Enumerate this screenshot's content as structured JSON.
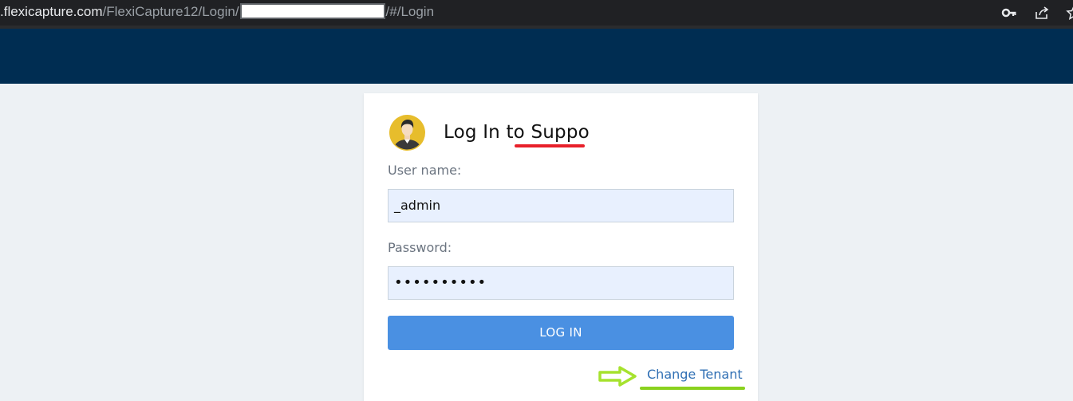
{
  "browser": {
    "url_host": ".flexicapture.com",
    "url_path_before": "/FlexiCapture12/Login/",
    "url_path_after": "/#/Login"
  },
  "login": {
    "title_prefix": "Log In to ",
    "tenant_name": "Suppo",
    "username_label": "User name:",
    "username_value": "_admin",
    "password_label": "Password:",
    "password_value": "••••••••••",
    "login_button": "LOG IN",
    "change_tenant_link": "Change Tenant"
  },
  "colors": {
    "header_bg": "#002d52",
    "page_bg": "#edf1f4",
    "button_bg": "#4a90e2",
    "link": "#2f6fb4",
    "annotation_red": "#e8202a",
    "annotation_green": "#8ad11e"
  },
  "icons": {
    "address_bar": [
      "key-icon",
      "share-icon",
      "star-icon"
    ],
    "card": "user-avatar-icon"
  }
}
